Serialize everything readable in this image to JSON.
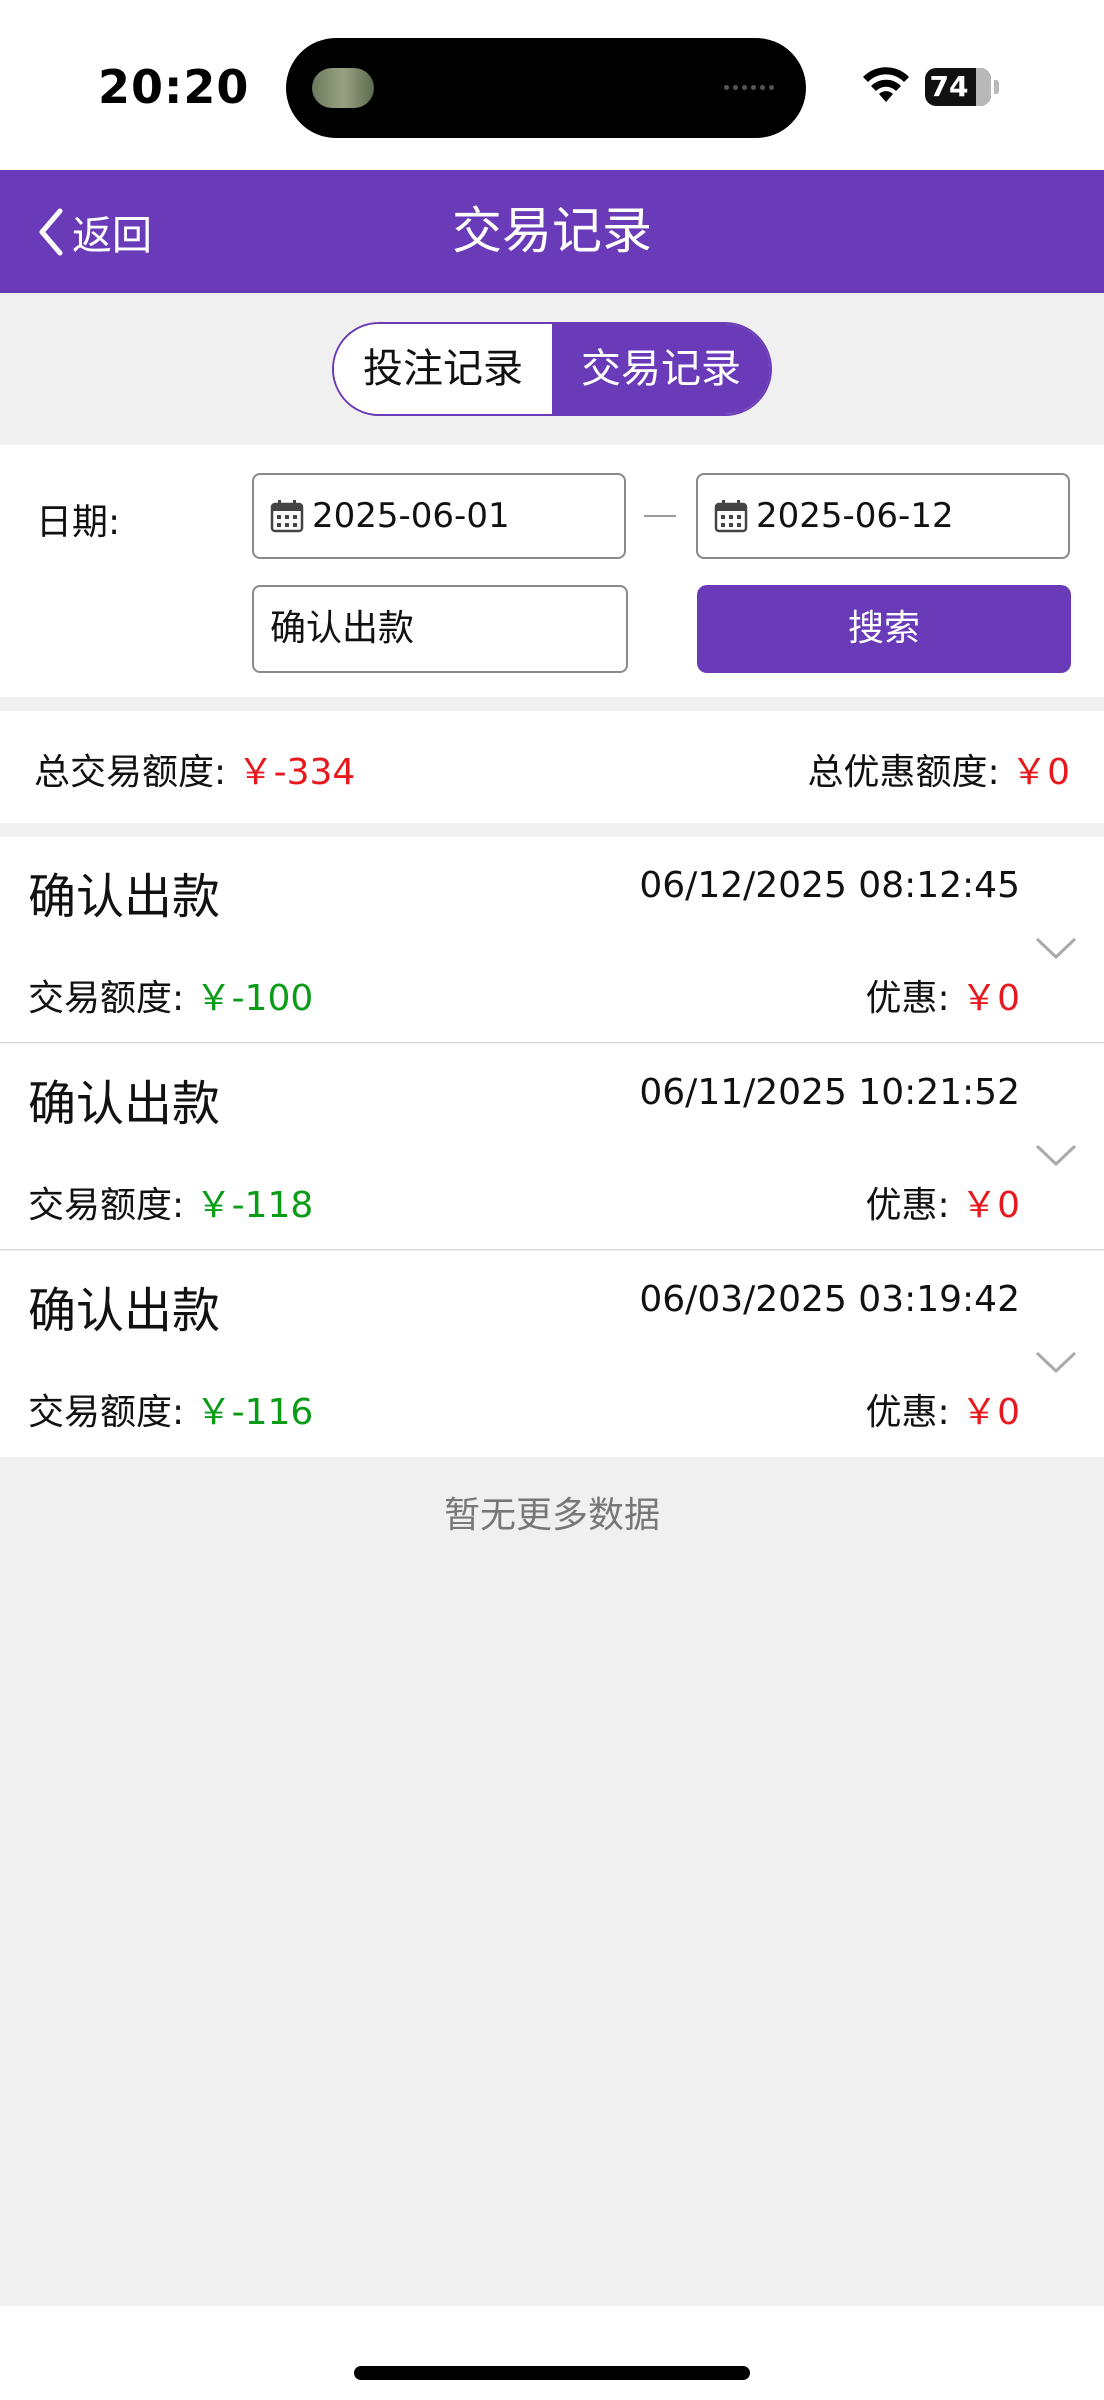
{
  "status_bar": {
    "time": "20:20",
    "battery": "74"
  },
  "header": {
    "back_label": "返回",
    "title": "交易记录"
  },
  "tabs": [
    {
      "label": "投注记录",
      "selected": false
    },
    {
      "label": "交易记录",
      "selected": true
    }
  ],
  "filter": {
    "date_label": "日期:",
    "start_date": "2025-06-01",
    "end_date": "2025-06-12",
    "type_value": "确认出款",
    "search_label": "搜索"
  },
  "summary": {
    "total_trade_label": "总交易额度:",
    "total_trade_value": "￥-334",
    "total_discount_label": "总优惠额度:",
    "total_discount_value": "￥0"
  },
  "records": [
    {
      "type": "确认出款",
      "time": "06/12/2025 08:12:45",
      "amount_label": "交易额度:",
      "amount": "￥-100",
      "discount_label": "优惠:",
      "discount": "￥0"
    },
    {
      "type": "确认出款",
      "time": "06/11/2025 10:21:52",
      "amount_label": "交易额度:",
      "amount": "￥-118",
      "discount_label": "优惠:",
      "discount": "￥0"
    },
    {
      "type": "确认出款",
      "time": "06/03/2025 03:19:42",
      "amount_label": "交易额度:",
      "amount": "￥-116",
      "discount_label": "优惠:",
      "discount": "￥0"
    }
  ],
  "footer_text": "暂无更多数据",
  "colors": {
    "primary": "#6a3bb8",
    "negative_red": "#e8191d",
    "amount_green": "#0a9b17"
  }
}
